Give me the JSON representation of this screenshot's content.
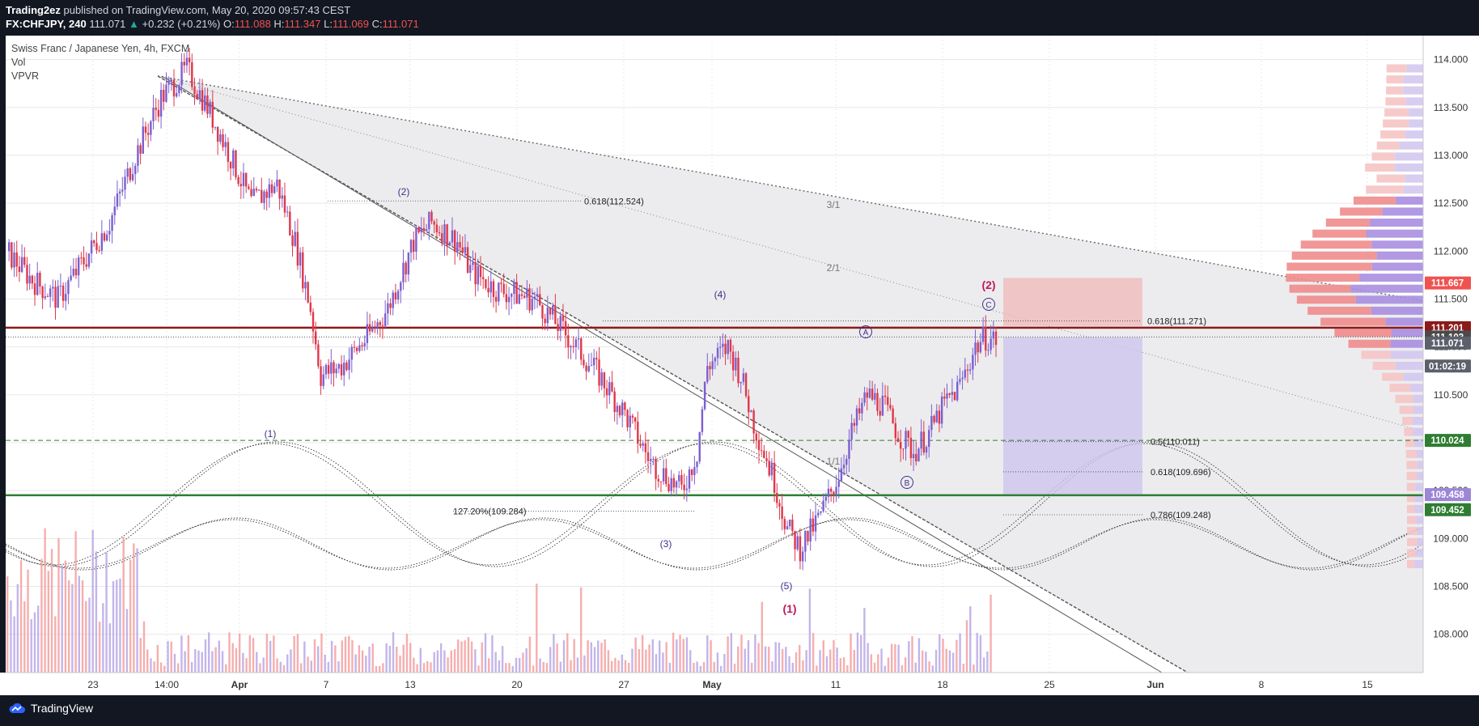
{
  "header": {
    "publisher": "Trading2ez",
    "published_text": "published on TradingView.com, May 20, 2020 09:57:43 CEST",
    "symbol": "FX:CHFJPY, 240",
    "last": "111.071",
    "change_arrow": "▲",
    "change": "+0.232 (+0.21%)",
    "o_label": "O:",
    "o": "111.088",
    "h_label": "H:",
    "h": "111.347",
    "l_label": "L:",
    "l": "111.069",
    "c_label": "C:",
    "c": "111.071"
  },
  "legend": {
    "title": "Swiss Franc / Japanese Yen, 4h, FXCM",
    "vol": "Vol",
    "vpvr": "VPVR"
  },
  "footer": {
    "brand": "TradingView"
  },
  "chart_data": {
    "type": "candlestick",
    "ylim": [
      107.6,
      114.25
    ],
    "x_ticks": [
      "23",
      "14:00",
      "Apr",
      "7",
      "13",
      "20",
      "27",
      "May",
      "11",
      "18",
      "25",
      "Jun",
      "8",
      "15"
    ],
    "y_ticks": [
      "114.000",
      "113.500",
      "113.000",
      "112.500",
      "112.000",
      "111.500",
      "111.000",
      "110.500",
      "110.000",
      "109.500",
      "109.000",
      "108.500",
      "108.000"
    ],
    "price_labels": [
      {
        "text": "111.667",
        "value": 111.667,
        "color": "#ef5350"
      },
      {
        "text": "111.201",
        "value": 111.201,
        "color": "#8b1a1a"
      },
      {
        "text": "111.103",
        "value": 111.103,
        "color": "#4a4a4a"
      },
      {
        "text": "111.071",
        "value": 111.04,
        "color": "#5d606b"
      },
      {
        "text": "01:02:19",
        "value": 110.8,
        "color": "#5d606b"
      },
      {
        "text": "110.024",
        "value": 110.024,
        "color": "#2e7d32"
      },
      {
        "text": "109.458",
        "value": 109.458,
        "color": "#9c86d6"
      },
      {
        "text": "109.452",
        "value": 109.3,
        "color": "#2e7d32"
      }
    ],
    "horizontal_levels": [
      {
        "name": "resistance",
        "value": 111.201,
        "color": "#8b1a1a"
      },
      {
        "name": "support",
        "value": 109.452,
        "color": "#2e7d32"
      },
      {
        "name": "dashed-level",
        "value": 110.024,
        "color": "#2e7d32"
      },
      {
        "name": "current-price",
        "value": 111.103,
        "color": "#555555"
      }
    ],
    "fib_labels": [
      {
        "text": "0.618(112.524)",
        "value": 112.524
      },
      {
        "text": "0.618(111.271)",
        "value": 111.271
      },
      {
        "text": "0.5(110.011)",
        "value": 110.011
      },
      {
        "text": "0.618(109.696)",
        "value": 109.696
      },
      {
        "text": "0.786(109.248)",
        "value": 109.248
      },
      {
        "text": "127.20%(109.284)",
        "value": 109.284
      }
    ],
    "wave_labels": [
      {
        "text": "(2)",
        "color": "#3f2f8a"
      },
      {
        "text": "(1)",
        "color": "#3f2f8a"
      },
      {
        "text": "(3)",
        "color": "#3f2f8a"
      },
      {
        "text": "(4)",
        "color": "#3f2f8a"
      },
      {
        "text": "(5)",
        "color": "#3f2f8a"
      },
      {
        "text": "(1)",
        "color": "#c2185b"
      },
      {
        "text": "(2)",
        "color": "#c2185b"
      },
      {
        "text": "A",
        "color": "#3f2f8a"
      },
      {
        "text": "B",
        "color": "#3f2f8a"
      },
      {
        "text": "C",
        "color": "#3f2f8a"
      }
    ],
    "fan_labels": [
      "3/1",
      "2/1",
      "1/1"
    ],
    "price_path": [
      [
        0,
        112.0
      ],
      [
        10,
        111.7
      ],
      [
        20,
        111.5
      ],
      [
        30,
        111.9
      ],
      [
        40,
        112.3
      ],
      [
        50,
        113.0
      ],
      [
        60,
        113.6
      ],
      [
        70,
        113.9
      ],
      [
        78,
        113.5
      ],
      [
        85,
        113.1
      ],
      [
        95,
        112.5
      ],
      [
        105,
        112.7
      ],
      [
        112,
        112.1
      ],
      [
        118,
        111.4
      ],
      [
        122,
        110.7
      ],
      [
        130,
        110.8
      ],
      [
        140,
        111.1
      ],
      [
        148,
        111.4
      ],
      [
        158,
        112.1
      ],
      [
        165,
        112.3
      ],
      [
        175,
        112.1
      ],
      [
        180,
        111.8
      ],
      [
        190,
        111.6
      ],
      [
        205,
        111.5
      ],
      [
        215,
        111.2
      ],
      [
        230,
        110.7
      ],
      [
        240,
        110.3
      ],
      [
        250,
        109.8
      ],
      [
        262,
        109.5
      ],
      [
        268,
        109.9
      ],
      [
        272,
        110.8
      ],
      [
        280,
        111.0
      ],
      [
        285,
        110.7
      ],
      [
        290,
        110.2
      ],
      [
        298,
        109.6
      ],
      [
        303,
        109.1
      ],
      [
        308,
        108.9
      ],
      [
        315,
        109.2
      ],
      [
        322,
        109.6
      ],
      [
        328,
        110.1
      ],
      [
        334,
        110.5
      ],
      [
        340,
        110.4
      ],
      [
        346,
        110.1
      ],
      [
        352,
        109.9
      ],
      [
        358,
        110.1
      ],
      [
        364,
        110.4
      ],
      [
        370,
        110.6
      ],
      [
        376,
        111.0
      ],
      [
        380,
        111.1
      ],
      [
        384,
        111.07
      ]
    ],
    "volume": {
      "max_bars": 384
    },
    "vpvr": {
      "bins": 46
    }
  }
}
